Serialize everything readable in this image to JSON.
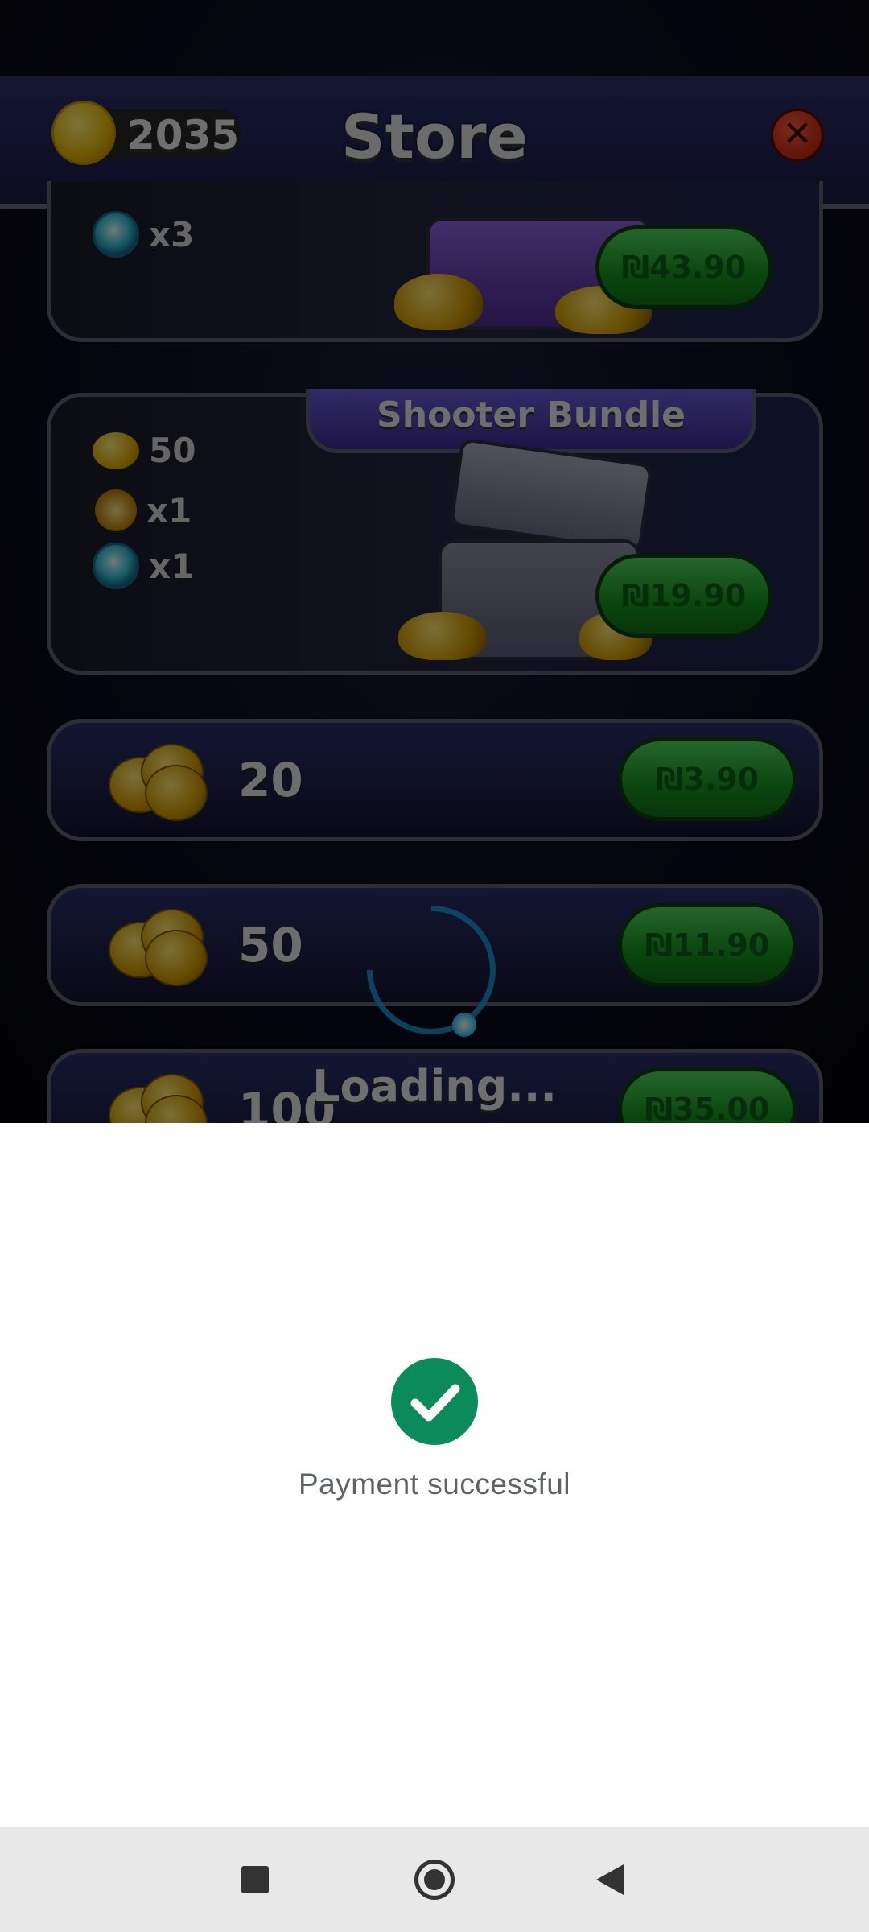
{
  "store": {
    "title": "Store",
    "coin_balance": "2035"
  },
  "top_bundle": {
    "items": [
      {
        "icon": "blue-orb-icon",
        "label": "x3"
      }
    ],
    "price": "₪43.90"
  },
  "shooter_bundle": {
    "title": "Shooter Bundle",
    "items": [
      {
        "icon": "coins-icon",
        "label": "50"
      },
      {
        "icon": "gold-orb-icon",
        "label": "x1"
      },
      {
        "icon": "blue-orb-icon",
        "label": "x1"
      }
    ],
    "price": "₪19.90"
  },
  "coin_packs": [
    {
      "amount": "20",
      "price": "₪3.90"
    },
    {
      "amount": "50",
      "price": "₪11.90"
    },
    {
      "amount": "100",
      "price": "₪35.00"
    }
  ],
  "loading_text": "Loading...",
  "payment": {
    "message": "Payment successful",
    "icon": "check-circle-icon",
    "accent": "#0b8a5b"
  },
  "navbar": {
    "icons": [
      "recents-icon",
      "home-icon",
      "back-icon"
    ]
  }
}
